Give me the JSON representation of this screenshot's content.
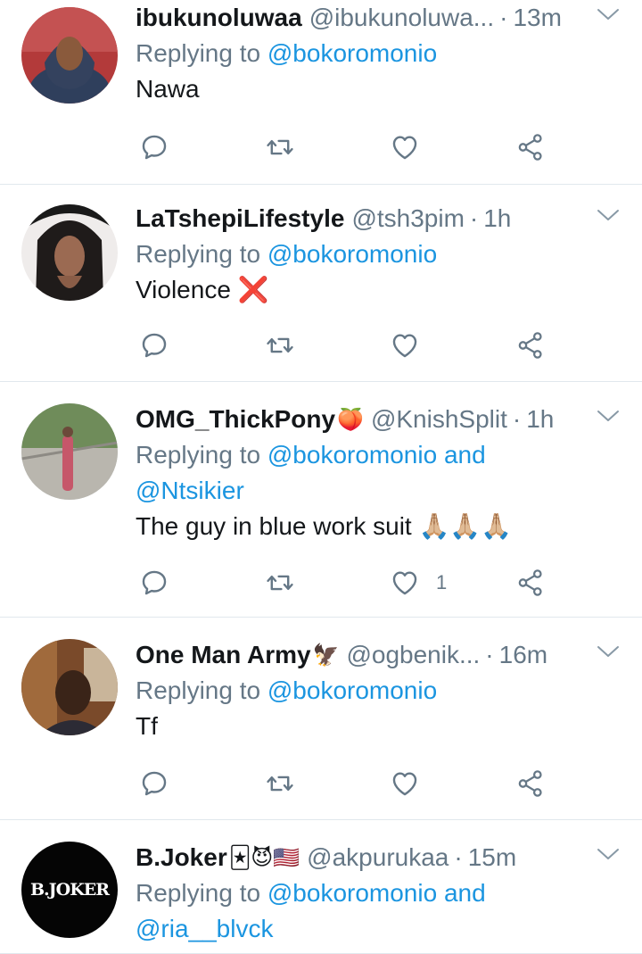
{
  "tweets": [
    {
      "name": "ibukunoluwaa",
      "name_emoji": "",
      "handle": "@ibukunoluwa...",
      "time": "13m",
      "replying_prefix": "Replying to",
      "mentions": "@bokoromonio",
      "mentions_line2": "",
      "text": "Nawa",
      "text_emoji": "",
      "like_count": ""
    },
    {
      "name": "LaTshepiLifestyle",
      "name_emoji": "",
      "handle": "@tsh3pim",
      "time": "1h",
      "replying_prefix": "Replying to",
      "mentions": "@bokoromonio",
      "mentions_line2": "",
      "text": "Violence",
      "text_emoji": "❌",
      "like_count": ""
    },
    {
      "name": "OMG_ThickPony",
      "name_emoji": "🍑",
      "handle": "@KnishSplit",
      "time": "1h",
      "replying_prefix": "Replying to",
      "mentions": "@bokoromonio and",
      "mentions_line2": "@Ntsikier",
      "text": "The guy in blue work suit",
      "text_emoji": "🙏🏼🙏🏼🙏🏼",
      "like_count": "1"
    },
    {
      "name": "One Man Army",
      "name_emoji": "🦅",
      "handle": "@ogbenik...",
      "time": "16m",
      "replying_prefix": "Replying to",
      "mentions": "@bokoromonio",
      "mentions_line2": "",
      "text": "Tf",
      "text_emoji": "",
      "like_count": ""
    },
    {
      "name": "B.Joker",
      "name_emoji": "🃏😈🇺🇸",
      "handle": "@akpurukaa",
      "time": "15m",
      "replying_prefix": "Replying to",
      "mentions": "@bokoromonio and",
      "mentions_line2": "@ria__blvck",
      "text": "",
      "text_emoji": "",
      "like_count": "",
      "avatar_text": "B.JOKER"
    }
  ],
  "dot": "·",
  "colors": {
    "accent": "#1b95e0",
    "muted": "#657786",
    "text": "#14171a",
    "divider": "#e1e8ed"
  },
  "icons": [
    "reply-icon",
    "retweet-icon",
    "like-icon",
    "share-icon",
    "chevron-down-icon"
  ]
}
